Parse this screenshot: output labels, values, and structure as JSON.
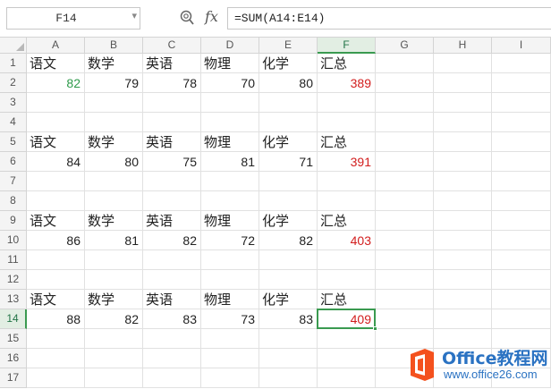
{
  "name_box": {
    "value": "F14"
  },
  "formula_bar": {
    "fx_label": "fx",
    "formula": "=SUM(A14:E14)"
  },
  "colors": {
    "green_number": "#2e9a4a",
    "red_sum": "#d21e1e",
    "selection": "#3a9a50",
    "logo_orange": "#f4511e",
    "logo_blue": "#2a72c2"
  },
  "active_cell": {
    "col": "F",
    "row": 14
  },
  "sheet": {
    "columns": [
      "A",
      "B",
      "C",
      "D",
      "E",
      "F",
      "G",
      "H",
      "I"
    ],
    "rows": [
      {
        "num": "1",
        "cells": [
          "语文",
          "数学",
          "英语",
          "物理",
          "化学",
          "汇总"
        ]
      },
      {
        "num": "2",
        "cells": [
          "82",
          "79",
          "78",
          "70",
          "80",
          "389"
        ]
      },
      {
        "num": "3",
        "cells": []
      },
      {
        "num": "4",
        "cells": []
      },
      {
        "num": "5",
        "cells": [
          "语文",
          "数学",
          "英语",
          "物理",
          "化学",
          "汇总"
        ]
      },
      {
        "num": "6",
        "cells": [
          "84",
          "80",
          "75",
          "81",
          "71",
          "391"
        ]
      },
      {
        "num": "7",
        "cells": []
      },
      {
        "num": "8",
        "cells": []
      },
      {
        "num": "9",
        "cells": [
          "语文",
          "数学",
          "英语",
          "物理",
          "化学",
          "汇总"
        ]
      },
      {
        "num": "10",
        "cells": [
          "86",
          "81",
          "82",
          "72",
          "82",
          "403"
        ]
      },
      {
        "num": "11",
        "cells": []
      },
      {
        "num": "12",
        "cells": []
      },
      {
        "num": "13",
        "cells": [
          "语文",
          "数学",
          "英语",
          "物理",
          "化学",
          "汇总"
        ]
      },
      {
        "num": "14",
        "cells": [
          "88",
          "82",
          "83",
          "73",
          "83",
          "409"
        ]
      },
      {
        "num": "15",
        "cells": []
      },
      {
        "num": "16",
        "cells": []
      },
      {
        "num": "17",
        "cells": []
      }
    ],
    "green_cells": [
      "A2"
    ],
    "red_cells": [
      "F2",
      "F6",
      "F10",
      "F14"
    ]
  },
  "watermark": {
    "title": "Office教程网",
    "url": "www.office26.com"
  }
}
